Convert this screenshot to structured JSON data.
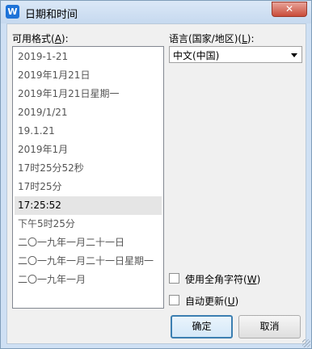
{
  "window": {
    "title": "日期和时间",
    "close_glyph": "✕",
    "app_icon_letter": "W"
  },
  "formats": {
    "label_text": "可用格式(",
    "label_key": "A",
    "label_end": "):",
    "items": [
      "2019-1-21",
      "2019年1月21日",
      "2019年1月21日星期一",
      "2019/1/21",
      "19.1.21",
      "2019年1月",
      "17时25分52秒",
      "17时25分",
      "17:25:52",
      "下午5时25分",
      "二〇一九年一月二十一日",
      "二〇一九年一月二十一日星期一",
      "二〇一九年一月"
    ],
    "selected_index": 8
  },
  "language": {
    "label_text": "语言(国家/地区)(",
    "label_key": "L",
    "label_end": "):",
    "value": "中文(中国)"
  },
  "options": {
    "fullwidth_text": "使用全角字符(",
    "fullwidth_key": "W",
    "fullwidth_end": ")",
    "fullwidth_checked": false,
    "autoupdate_text": "自动更新(",
    "autoupdate_key": "U",
    "autoupdate_end": ")",
    "autoupdate_checked": false
  },
  "buttons": {
    "ok": "确定",
    "cancel": "取消"
  },
  "colors": {
    "accent": "#1e73d8",
    "selection": "#e5e5e5",
    "close": "#c94c3a"
  }
}
